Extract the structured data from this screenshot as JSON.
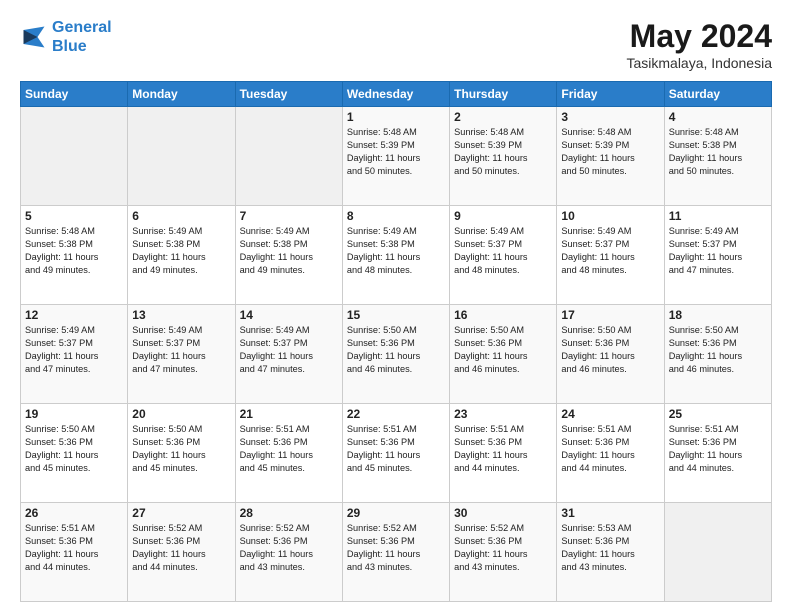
{
  "header": {
    "logo_line1": "General",
    "logo_line2": "Blue",
    "month_year": "May 2024",
    "location": "Tasikmalaya, Indonesia"
  },
  "weekdays": [
    "Sunday",
    "Monday",
    "Tuesday",
    "Wednesday",
    "Thursday",
    "Friday",
    "Saturday"
  ],
  "weeks": [
    [
      {
        "day": "",
        "info": ""
      },
      {
        "day": "",
        "info": ""
      },
      {
        "day": "",
        "info": ""
      },
      {
        "day": "1",
        "info": "Sunrise: 5:48 AM\nSunset: 5:39 PM\nDaylight: 11 hours\nand 50 minutes."
      },
      {
        "day": "2",
        "info": "Sunrise: 5:48 AM\nSunset: 5:39 PM\nDaylight: 11 hours\nand 50 minutes."
      },
      {
        "day": "3",
        "info": "Sunrise: 5:48 AM\nSunset: 5:39 PM\nDaylight: 11 hours\nand 50 minutes."
      },
      {
        "day": "4",
        "info": "Sunrise: 5:48 AM\nSunset: 5:38 PM\nDaylight: 11 hours\nand 50 minutes."
      }
    ],
    [
      {
        "day": "5",
        "info": "Sunrise: 5:48 AM\nSunset: 5:38 PM\nDaylight: 11 hours\nand 49 minutes."
      },
      {
        "day": "6",
        "info": "Sunrise: 5:49 AM\nSunset: 5:38 PM\nDaylight: 11 hours\nand 49 minutes."
      },
      {
        "day": "7",
        "info": "Sunrise: 5:49 AM\nSunset: 5:38 PM\nDaylight: 11 hours\nand 49 minutes."
      },
      {
        "day": "8",
        "info": "Sunrise: 5:49 AM\nSunset: 5:38 PM\nDaylight: 11 hours\nand 48 minutes."
      },
      {
        "day": "9",
        "info": "Sunrise: 5:49 AM\nSunset: 5:37 PM\nDaylight: 11 hours\nand 48 minutes."
      },
      {
        "day": "10",
        "info": "Sunrise: 5:49 AM\nSunset: 5:37 PM\nDaylight: 11 hours\nand 48 minutes."
      },
      {
        "day": "11",
        "info": "Sunrise: 5:49 AM\nSunset: 5:37 PM\nDaylight: 11 hours\nand 47 minutes."
      }
    ],
    [
      {
        "day": "12",
        "info": "Sunrise: 5:49 AM\nSunset: 5:37 PM\nDaylight: 11 hours\nand 47 minutes."
      },
      {
        "day": "13",
        "info": "Sunrise: 5:49 AM\nSunset: 5:37 PM\nDaylight: 11 hours\nand 47 minutes."
      },
      {
        "day": "14",
        "info": "Sunrise: 5:49 AM\nSunset: 5:37 PM\nDaylight: 11 hours\nand 47 minutes."
      },
      {
        "day": "15",
        "info": "Sunrise: 5:50 AM\nSunset: 5:36 PM\nDaylight: 11 hours\nand 46 minutes."
      },
      {
        "day": "16",
        "info": "Sunrise: 5:50 AM\nSunset: 5:36 PM\nDaylight: 11 hours\nand 46 minutes."
      },
      {
        "day": "17",
        "info": "Sunrise: 5:50 AM\nSunset: 5:36 PM\nDaylight: 11 hours\nand 46 minutes."
      },
      {
        "day": "18",
        "info": "Sunrise: 5:50 AM\nSunset: 5:36 PM\nDaylight: 11 hours\nand 46 minutes."
      }
    ],
    [
      {
        "day": "19",
        "info": "Sunrise: 5:50 AM\nSunset: 5:36 PM\nDaylight: 11 hours\nand 45 minutes."
      },
      {
        "day": "20",
        "info": "Sunrise: 5:50 AM\nSunset: 5:36 PM\nDaylight: 11 hours\nand 45 minutes."
      },
      {
        "day": "21",
        "info": "Sunrise: 5:51 AM\nSunset: 5:36 PM\nDaylight: 11 hours\nand 45 minutes."
      },
      {
        "day": "22",
        "info": "Sunrise: 5:51 AM\nSunset: 5:36 PM\nDaylight: 11 hours\nand 45 minutes."
      },
      {
        "day": "23",
        "info": "Sunrise: 5:51 AM\nSunset: 5:36 PM\nDaylight: 11 hours\nand 44 minutes."
      },
      {
        "day": "24",
        "info": "Sunrise: 5:51 AM\nSunset: 5:36 PM\nDaylight: 11 hours\nand 44 minutes."
      },
      {
        "day": "25",
        "info": "Sunrise: 5:51 AM\nSunset: 5:36 PM\nDaylight: 11 hours\nand 44 minutes."
      }
    ],
    [
      {
        "day": "26",
        "info": "Sunrise: 5:51 AM\nSunset: 5:36 PM\nDaylight: 11 hours\nand 44 minutes."
      },
      {
        "day": "27",
        "info": "Sunrise: 5:52 AM\nSunset: 5:36 PM\nDaylight: 11 hours\nand 44 minutes."
      },
      {
        "day": "28",
        "info": "Sunrise: 5:52 AM\nSunset: 5:36 PM\nDaylight: 11 hours\nand 43 minutes."
      },
      {
        "day": "29",
        "info": "Sunrise: 5:52 AM\nSunset: 5:36 PM\nDaylight: 11 hours\nand 43 minutes."
      },
      {
        "day": "30",
        "info": "Sunrise: 5:52 AM\nSunset: 5:36 PM\nDaylight: 11 hours\nand 43 minutes."
      },
      {
        "day": "31",
        "info": "Sunrise: 5:53 AM\nSunset: 5:36 PM\nDaylight: 11 hours\nand 43 minutes."
      },
      {
        "day": "",
        "info": ""
      }
    ]
  ]
}
